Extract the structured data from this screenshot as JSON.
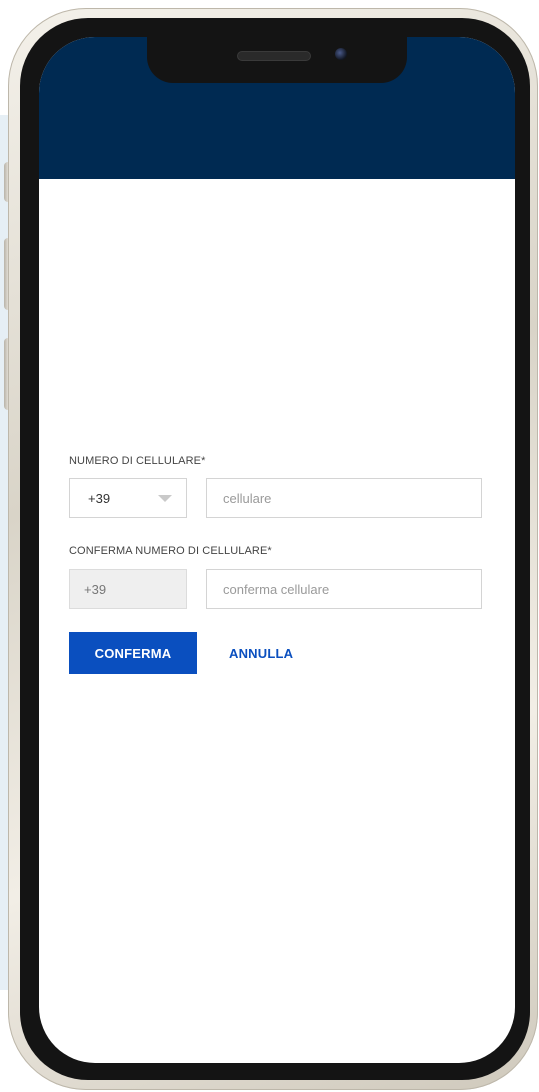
{
  "form": {
    "phone_label": "NUMERO DI CELLULARE*",
    "phone_prefix": "+39",
    "phone_placeholder": "cellulare",
    "confirm_label": "CONFERMA NUMERO DI CELLULARE*",
    "confirm_prefix": "+39",
    "confirm_placeholder": "conferma cellulare"
  },
  "actions": {
    "confirm_label": "CONFERMA",
    "cancel_label": "ANNULLA"
  },
  "colors": {
    "header": "#002a52",
    "accent": "#0a4fbf"
  },
  "icons": {
    "prefix_dropdown": "caret-down-icon"
  }
}
